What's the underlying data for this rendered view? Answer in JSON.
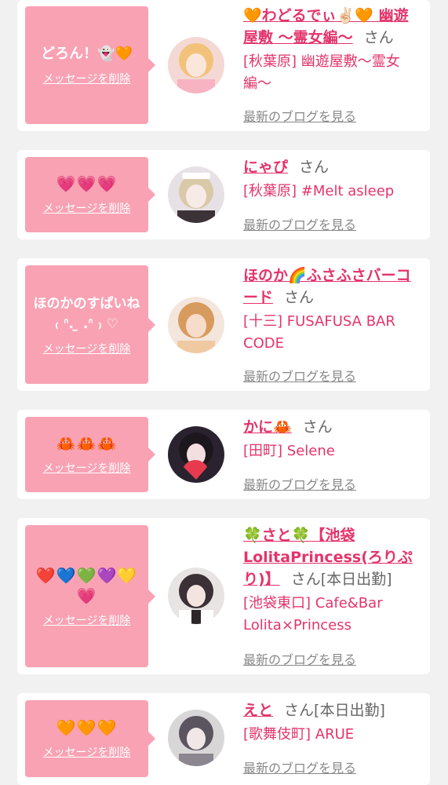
{
  "delete_label": "メッセージを削除",
  "blog_label": "最新のブログを見る",
  "san_label": "さん",
  "colors": {
    "bubble": "#f9a2b4",
    "accent": "#e4346b",
    "background": "#f1f1f1"
  },
  "cards": [
    {
      "message": "どろん！👻🧡",
      "name": "🧡わどるでぃ✌🏻🧡 幽遊屋敷 〜霊女編〜",
      "status": "",
      "shop": "[秋葉原] 幽遊屋敷〜霊女編〜",
      "avatar_colors": [
        "#f4d8d4",
        "#f2c27a"
      ]
    },
    {
      "message": "💗💗💗",
      "name": "にゃぴ",
      "status": "",
      "shop": "[秋葉原] #Melt asleep",
      "avatar_colors": [
        "#e7e1e6",
        "#d9c9a8"
      ]
    },
    {
      "message": "ほのかのすぱいね ₍ ᐢ. ̫ .ᐢ ₎ ♡",
      "name": "ほのか🌈ふさふさバーコード",
      "status": "",
      "shop": "[十三] FUSAFUSA BAR CODE",
      "avatar_colors": [
        "#efc9a2",
        "#d89b5e"
      ]
    },
    {
      "message": "🦀🦀🦀",
      "name": "かに🦀",
      "status": "",
      "shop": "[田町] Selene",
      "avatar_colors": [
        "#2b2230",
        "#e83a4f"
      ]
    },
    {
      "message": "❤️💙💚💜💛💗",
      "name": "🍀さと🍀【池袋LolitaPrincess(ろりぷり)】",
      "status": "[本日出勤]",
      "shop": "[池袋東口] Cafe&Bar Lolita×Princess",
      "avatar_colors": [
        "#e9e4e4",
        "#3a3035"
      ]
    },
    {
      "message": "🧡🧡🧡",
      "name": "えと",
      "status": "[本日出勤]",
      "shop": "[歌舞伎町] ARUE",
      "avatar_colors": [
        "#d9d6d8",
        "#5b5560"
      ]
    }
  ]
}
